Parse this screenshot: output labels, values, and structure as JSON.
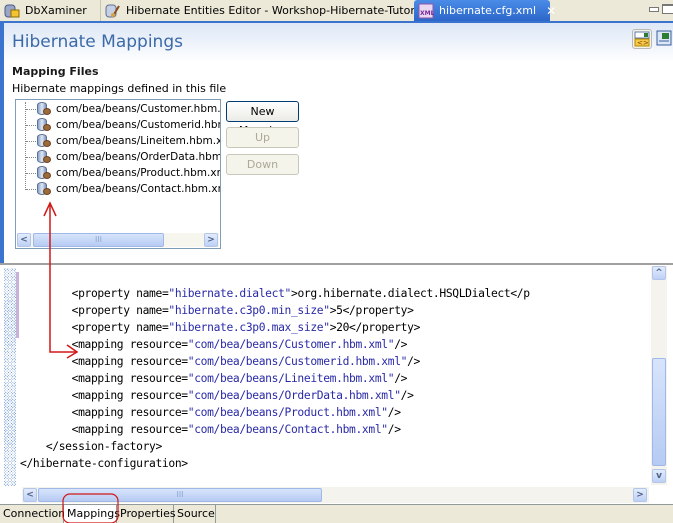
{
  "tabs": [
    {
      "label": "DbXaminer",
      "icon": "db-examiner-icon",
      "active": false
    },
    {
      "label": "Hibernate Entities Editor - Workshop-Hibernate-Tutorial",
      "icon": "hibernate-editor-icon",
      "active": false
    },
    {
      "label": "hibernate.cfg.xml",
      "icon": "xml-file-icon",
      "active": true,
      "close": "✕"
    }
  ],
  "header": {
    "title": "Hibernate Mappings"
  },
  "mapping_files": {
    "section_title": "Mapping Files",
    "description": "Hibernate mappings defined in this file",
    "items": [
      "com/bea/beans/Customer.hbm.xml",
      "com/bea/beans/Customerid.hbm.xml",
      "com/bea/beans/Lineitem.hbm.xml",
      "com/bea/beans/OrderData.hbm.xml",
      "com/bea/beans/Product.hbm.xml",
      "com/bea/beans/Contact.hbm.xml"
    ],
    "buttons": {
      "new_mapping": "New Mapping",
      "up": "Up",
      "down": "Down"
    }
  },
  "scroll": {
    "left": "<",
    "right": ">",
    "up": "^",
    "down": "v",
    "grip": "III"
  },
  "editor": {
    "lines": [
      {
        "indent": "        ",
        "parts": [
          [
            "tag",
            "<property "
          ],
          [
            "attr",
            "name="
          ],
          [
            "val",
            "\"hibernate.dialect\""
          ],
          [
            "tag",
            ">"
          ],
          [
            "txt",
            "org.hibernate.dialect.HSQLDialect</p"
          ]
        ]
      },
      {
        "indent": "        ",
        "parts": [
          [
            "tag",
            "<property "
          ],
          [
            "attr",
            "name="
          ],
          [
            "val",
            "\"hibernate.c3p0.min_size\""
          ],
          [
            "tag",
            ">"
          ],
          [
            "txt",
            "5</property>"
          ]
        ]
      },
      {
        "indent": "        ",
        "parts": [
          [
            "tag",
            "<property "
          ],
          [
            "attr",
            "name="
          ],
          [
            "val",
            "\"hibernate.c3p0.max_size\""
          ],
          [
            "tag",
            ">"
          ],
          [
            "txt",
            "20</property>"
          ]
        ]
      },
      {
        "indent": "        ",
        "parts": [
          [
            "tag",
            "<mapping "
          ],
          [
            "attr",
            "resource="
          ],
          [
            "val",
            "\"com/bea/beans/Customer.hbm.xml\""
          ],
          [
            "tag",
            "/>"
          ]
        ]
      },
      {
        "indent": "        ",
        "parts": [
          [
            "tag",
            "<mapping "
          ],
          [
            "attr",
            "resource="
          ],
          [
            "val",
            "\"com/bea/beans/Customerid.hbm.xml\""
          ],
          [
            "tag",
            "/>"
          ]
        ]
      },
      {
        "indent": "        ",
        "parts": [
          [
            "tag",
            "<mapping "
          ],
          [
            "attr",
            "resource="
          ],
          [
            "val",
            "\"com/bea/beans/Lineitem.hbm.xml\""
          ],
          [
            "tag",
            "/>"
          ]
        ]
      },
      {
        "indent": "        ",
        "parts": [
          [
            "tag",
            "<mapping "
          ],
          [
            "attr",
            "resource="
          ],
          [
            "val",
            "\"com/bea/beans/OrderData.hbm.xml\""
          ],
          [
            "tag",
            "/>"
          ]
        ]
      },
      {
        "indent": "        ",
        "parts": [
          [
            "tag",
            "<mapping "
          ],
          [
            "attr",
            "resource="
          ],
          [
            "val",
            "\"com/bea/beans/Product.hbm.xml\""
          ],
          [
            "tag",
            "/>"
          ]
        ]
      },
      {
        "indent": "        ",
        "parts": [
          [
            "tag",
            "<mapping "
          ],
          [
            "attr",
            "resource="
          ],
          [
            "val",
            "\"com/bea/beans/Contact.hbm.xml\""
          ],
          [
            "tag",
            "/>"
          ]
        ]
      },
      {
        "indent": "    ",
        "parts": [
          [
            "tag",
            "</session-factory>"
          ]
        ]
      },
      {
        "indent": "",
        "parts": [
          [
            "tag",
            "</hibernate-configuration>"
          ]
        ]
      }
    ]
  },
  "bottom_tabs": [
    {
      "label": "Connection",
      "active": false
    },
    {
      "label": "Mappings",
      "active": true
    },
    {
      "label": "Properties",
      "active": false
    },
    {
      "label": "Source",
      "active": false
    }
  ],
  "colors": {
    "accent": "#3a74cf",
    "title": "#3b6aa8",
    "xml_value": "#2a2aa8",
    "annotation": "#d01818"
  }
}
